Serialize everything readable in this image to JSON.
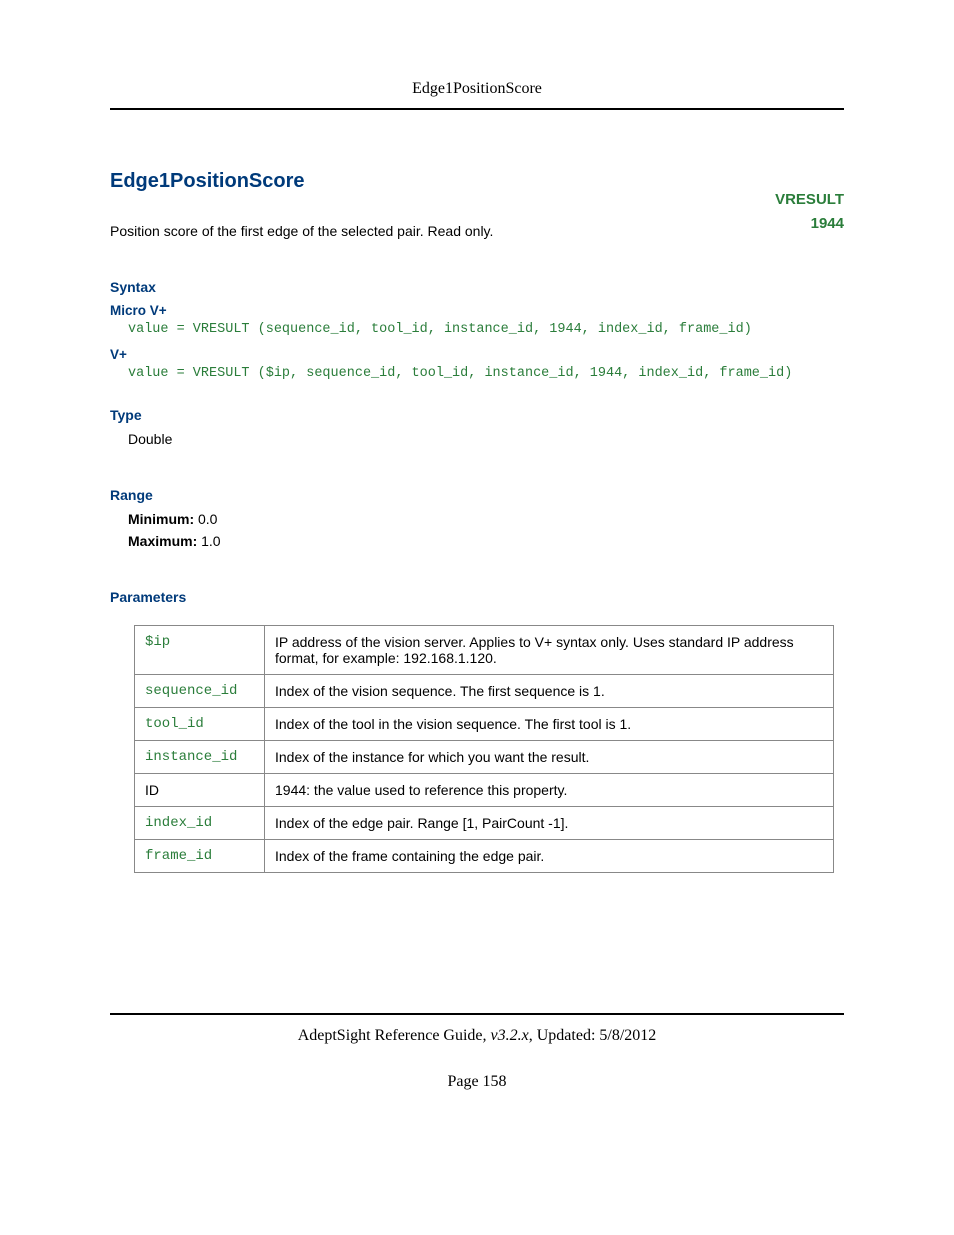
{
  "header": {
    "title": "Edge1PositionScore"
  },
  "title": "Edge1PositionScore",
  "badge": {
    "type": "VRESULT",
    "id": "1944"
  },
  "description": "Position score of the first edge of the selected pair. Read only.",
  "syntax": {
    "heading": "Syntax",
    "micro_label": "Micro V+",
    "micro_code": "value = VRESULT (sequence_id, tool_id, instance_id, 1944, index_id, frame_id)",
    "vplus_label": "V+",
    "vplus_code": "value = VRESULT ($ip, sequence_id, tool_id, instance_id, 1944, index_id, frame_id)"
  },
  "type_section": {
    "heading": "Type",
    "value": "Double"
  },
  "range": {
    "heading": "Range",
    "min_label": "Minimum:",
    "min_value": "0.0",
    "max_label": "Maximum:",
    "max_value": "1.0"
  },
  "parameters": {
    "heading": "Parameters",
    "rows": [
      {
        "name": "$ip",
        "desc": "IP address of the vision server. Applies to V+ syntax only. Uses standard IP address format, for example: 192.168.1.120.",
        "code": true
      },
      {
        "name": "sequence_id",
        "desc": "Index of the vision sequence. The first sequence is 1.",
        "code": true
      },
      {
        "name": "tool_id",
        "desc": "Index of the tool in the vision sequence. The first tool is 1.",
        "code": true
      },
      {
        "name": "instance_id",
        "desc": "Index of the instance for which you want the result.",
        "code": true
      },
      {
        "name": "ID",
        "desc": "1944: the value used to reference this property.",
        "code": false
      },
      {
        "name": "index_id",
        "desc": "Index of the edge pair. Range [1, PairCount -1].",
        "code": true
      },
      {
        "name": "frame_id",
        "desc": "Index of the frame containing the edge pair.",
        "code": true
      }
    ]
  },
  "footer": {
    "guide": "AdeptSight Reference Guide",
    "version": ", v3.2.x",
    "updated": ", Updated: 5/8/2012",
    "page": "Page 158"
  }
}
